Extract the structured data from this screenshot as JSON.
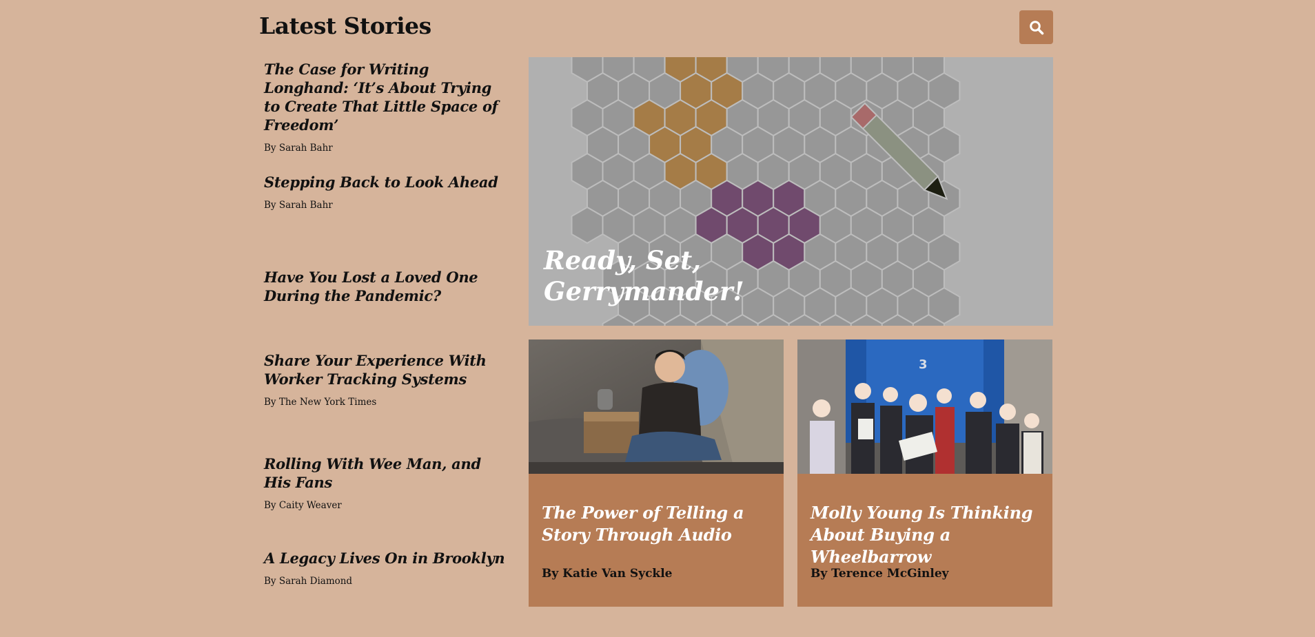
{
  "header": {
    "title": "Latest Stories",
    "search_label": "Search"
  },
  "stories": [
    {
      "title": "The Case for Writing Longhand: ‘It’s About Trying to Create That Little Space of Freedom’",
      "byline": "By Sarah Bahr"
    },
    {
      "title": "Stepping Back to Look Ahead",
      "byline": "By Sarah Bahr"
    },
    {
      "title": "Have You Lost a Loved One During the Pandemic?",
      "byline": ""
    },
    {
      "title": "Share Your Experience With Worker Tracking Systems",
      "byline": "By The New York Times"
    },
    {
      "title": "Rolling With Wee Man, and His Fans",
      "byline": "By Caity Weaver"
    },
    {
      "title": "A Legacy Lives On in Brooklyn",
      "byline": "By Sarah Diamond"
    }
  ],
  "hero": {
    "title": "Ready, Set, Gerrymander!"
  },
  "cards": [
    {
      "title": "The Power of Telling a Story Through Audio",
      "byline": "By Katie Van Syckle"
    },
    {
      "title": "Molly Young Is Thinking About Buying a Wheelbarrow",
      "byline": "By Terence McGinley"
    }
  ],
  "colors": {
    "background": "#d6b49b",
    "accent": "#b67c55",
    "hex_gold": "#a57c47",
    "hex_purple": "#704a6d",
    "hex_gray": "#979797"
  },
  "icons": {
    "search": "search-icon",
    "pencil": "pencil-icon"
  }
}
